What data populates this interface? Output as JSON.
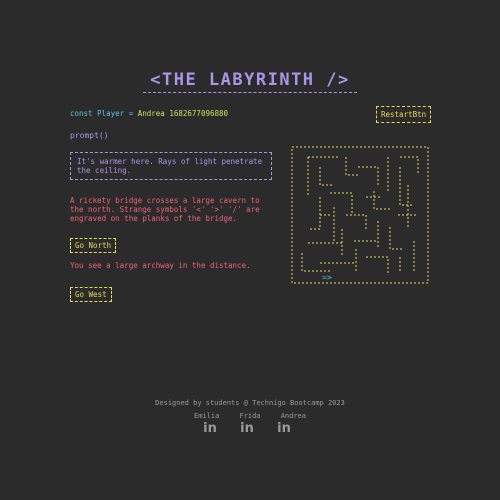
{
  "header": {
    "title": "<THE LABYRINTH />"
  },
  "player": {
    "prefix": "const Player = ",
    "name": "Andrea 1682677096880"
  },
  "restart_label": "RestartBtn",
  "prompt_label": "prompt()",
  "description": "It's warmer here. Rays of light penetrate the ceiling.",
  "stories": [
    "A rickety bridge crosses a large cavern to the north. Strange symbols '<' '>' '/' are engraved on the planks of the bridge.",
    "You see a large archway in the distance."
  ],
  "directions": [
    "Go North",
    "Go West"
  ],
  "maze": {
    "arrow": "=>",
    "wall_color": "#e8d858",
    "arrow_color": "#5cc0e0"
  },
  "footer": {
    "credit": "Designed by students @ Technigo Bootcamp 2023",
    "authors": [
      "Emilia",
      "Frida",
      "Andrea"
    ],
    "icon_glyph": "in"
  },
  "colors": {
    "background": "#2b2b2b",
    "title": "#a996e8",
    "accent_yellow": "#e8d858",
    "accent_pink": "#f0607a",
    "accent_cyan": "#5cc0e0"
  }
}
